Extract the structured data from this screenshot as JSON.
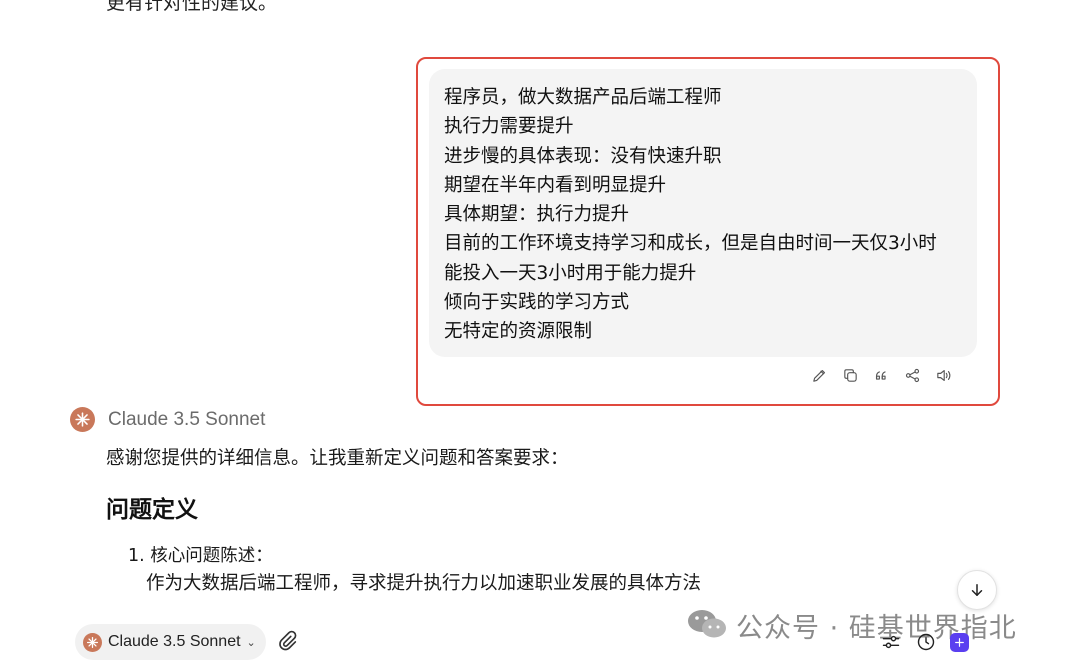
{
  "top_cut_text": "更有针对性的建议。",
  "user_message": {
    "lines": [
      "程序员，做大数据产品后端工程师",
      "执行力需要提升",
      "进步慢的具体表现：没有快速升职",
      "期望在半年内看到明显提升",
      "具体期望：执行力提升",
      "目前的工作环境支持学习和成长，但是自由时间一天仅3小时",
      "能投入一天3小时用于能力提升",
      "倾向于实践的学习方式",
      "无特定的资源限制"
    ],
    "actions": [
      "edit-icon",
      "copy-icon",
      "quote-icon",
      "share-icon",
      "speaker-icon"
    ]
  },
  "assistant": {
    "model_name": "Claude 3.5 Sonnet",
    "intro": "感谢您提供的详细信息。让我重新定义问题和答案要求：",
    "section_heading": "问题定义",
    "list": [
      {
        "number": "1.",
        "title": "核心问题陈述：",
        "body": "作为大数据后端工程师，寻求提升执行力以加速职业发展的具体方法"
      }
    ]
  },
  "input_bar": {
    "model_selector": "Claude 3.5 Sonnet",
    "chevron": "⌄"
  },
  "watermark": {
    "text": "公众号 · 硅基世界指北"
  },
  "colors": {
    "highlight_border": "#e0493d",
    "bubble_bg": "#f4f4f4",
    "claude_brand": "#c9785a",
    "new_chat": "#5a3ff0"
  }
}
